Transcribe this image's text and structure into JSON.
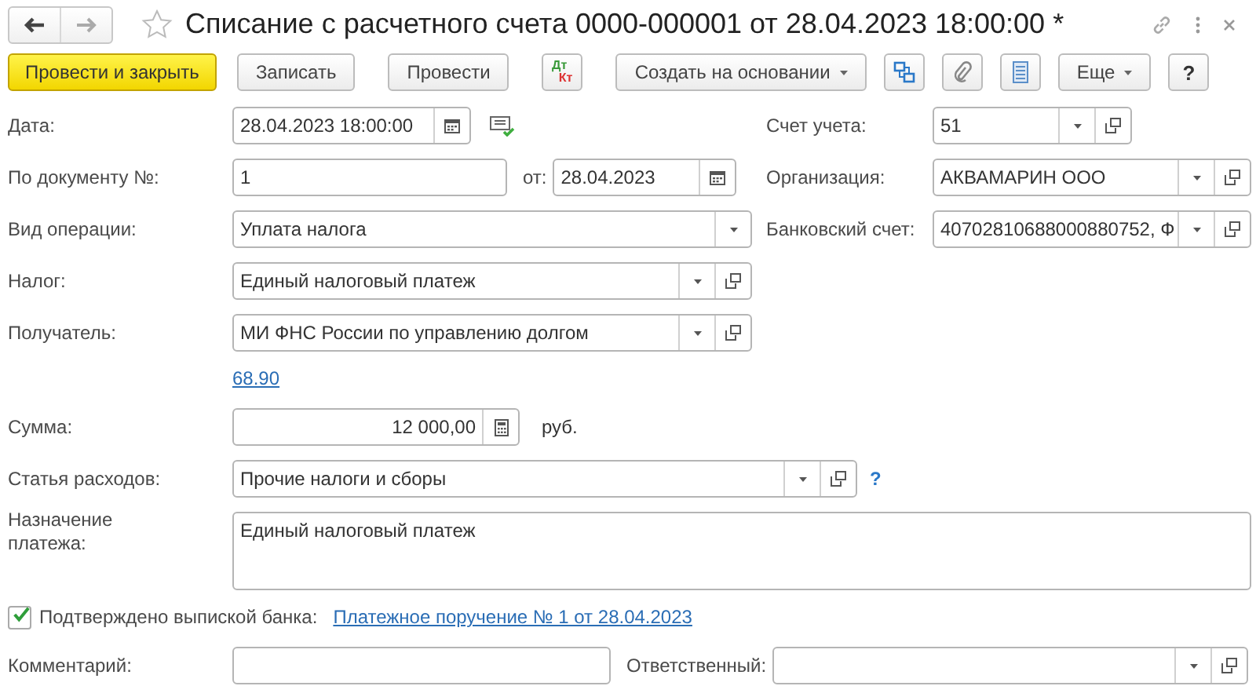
{
  "title": "Списание с расчетного счета 0000-000001 от 28.04.2023 18:00:00 *",
  "toolbar": [
    {
      "kind": "primary",
      "label": "Провести и закрыть"
    },
    {
      "kind": "plain",
      "label": "Записать"
    },
    {
      "kind": "plain",
      "label": "Провести"
    },
    {
      "kind": "dtkt",
      "top": "Дт",
      "bottom": "Кт"
    },
    {
      "kind": "menu",
      "label": "Создать на основании"
    },
    {
      "kind": "structure"
    },
    {
      "kind": "attach"
    },
    {
      "kind": "list"
    },
    {
      "kind": "menu",
      "label": "Еще"
    },
    {
      "kind": "help",
      "label": "?"
    }
  ],
  "fields": {
    "date": {
      "label": "Дата:",
      "value": "28.04.2023 18:00:00",
      "kind": "datetime"
    },
    "doc_number": {
      "label": "По документу №:",
      "value": "1",
      "kind": "text"
    },
    "doc_date": {
      "label": "от:",
      "value": "28.04.2023",
      "kind": "datetime"
    },
    "operation": {
      "label": "Вид операции:",
      "value": "Уплата налога",
      "kind": "select"
    },
    "tax": {
      "label": "Налог:",
      "value": "Единый налоговый платеж",
      "kind": "reference"
    },
    "recipient": {
      "label": "Получатель:",
      "value": "МИ ФНС России по управлению долгом",
      "kind": "reference"
    },
    "account": {
      "label": "Счет учета:",
      "value": "51",
      "kind": "reference"
    },
    "organization": {
      "label": "Организация:",
      "value": "АКВАМАРИН ООО",
      "kind": "reference"
    },
    "bank_account": {
      "label": "Банковский счет:",
      "value": "40702810688000880752, Ф",
      "kind": "reference"
    },
    "amount": {
      "label": "Сумма:",
      "value": "12 000,00",
      "kind": "number",
      "unit": "руб."
    },
    "expense_item": {
      "label": "Статья расходов:",
      "value": "Прочие налоги и сборы",
      "kind": "reference",
      "help": "?"
    },
    "purpose": {
      "label": "Назначение платежа:",
      "value": "Единый налоговый платеж",
      "kind": "textarea"
    },
    "comment": {
      "label": "Комментарий:",
      "kind": "text"
    },
    "responsible": {
      "label": "Ответственный:",
      "kind": "reference"
    }
  },
  "account_link": "68.90",
  "confirmed": {
    "label": "Подтверждено выпиской банка:",
    "checked": true,
    "link": "Платежное поручение № 1 от 28.04.2023"
  }
}
